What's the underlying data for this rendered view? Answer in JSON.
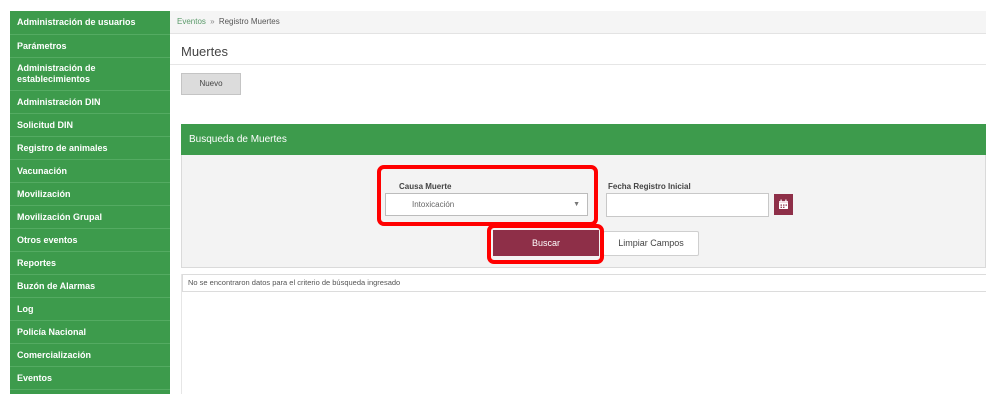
{
  "sidebar": {
    "items": [
      {
        "label": "Administración de usuarios"
      },
      {
        "label": "Parámetros"
      },
      {
        "label": "Administración de establecimientos"
      },
      {
        "label": "Administración DIN"
      },
      {
        "label": "Solicitud DIN"
      },
      {
        "label": "Registro de animales"
      },
      {
        "label": "Vacunación"
      },
      {
        "label": "Movilización"
      },
      {
        "label": "Movilización Grupal"
      },
      {
        "label": "Otros eventos"
      },
      {
        "label": "Reportes"
      },
      {
        "label": "Buzón de Alarmas"
      },
      {
        "label": "Log"
      },
      {
        "label": "Policía Nacional"
      },
      {
        "label": "Comercialización"
      },
      {
        "label": "Eventos"
      }
    ]
  },
  "breadcrumb": {
    "parent": "Eventos",
    "separator": "»",
    "current": "Registro Muertes"
  },
  "page": {
    "title": "Muertes",
    "new_button": "Nuevo"
  },
  "search_panel": {
    "title": "Busqueda de Muertes",
    "cause_label": "Causa Muerte",
    "cause_value": "Intoxicación",
    "date_label": "Fecha Registro Inicial",
    "date_value": "",
    "search_button": "Buscar",
    "clear_button": "Limpiar Campos"
  },
  "results": {
    "message": "No se encontraron datos para el criterio de búsqueda ingresado"
  },
  "colors": {
    "sidebar_green": "#3d9b4c",
    "header_green": "#3d9b4c",
    "button_maroon": "#8e2f48",
    "highlight_red": "#ff0000"
  },
  "icons": {
    "calendar": "calendar-icon",
    "select_chevron": "chevron-down-icon"
  }
}
